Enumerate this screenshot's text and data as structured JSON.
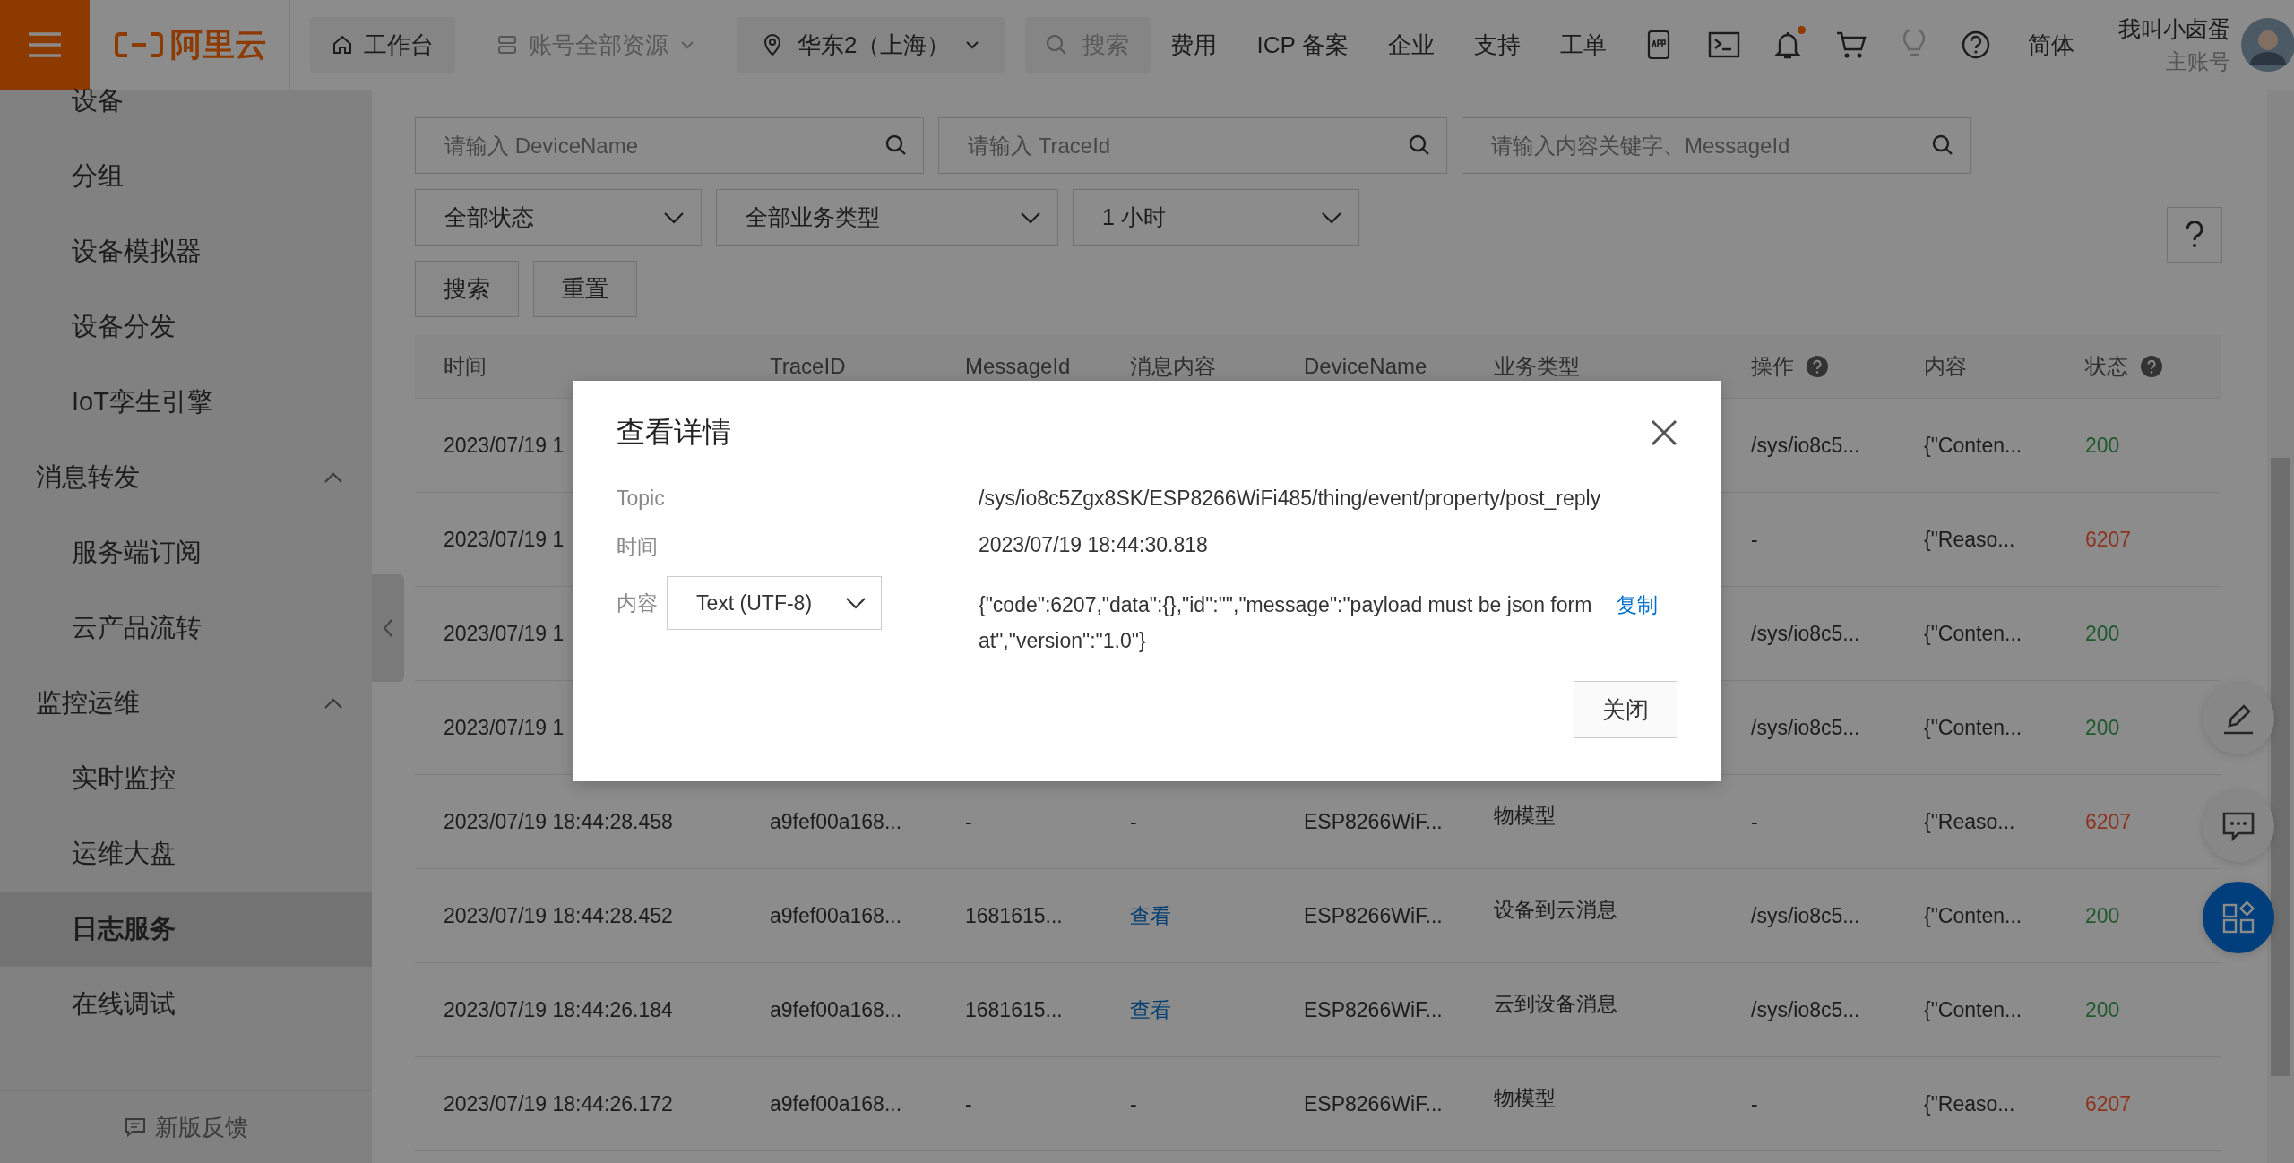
{
  "topbar": {
    "brand": "阿里云",
    "workbench": "工作台",
    "resources": "账号全部资源",
    "region": "华东2（上海）",
    "search_placeholder": "搜索",
    "links": [
      "费用",
      "ICP 备案",
      "企业",
      "支持",
      "工单"
    ],
    "notification_dot": true,
    "language": "简体",
    "user": {
      "name": "我叫小卤蛋",
      "role": "主账号"
    }
  },
  "sidebar": {
    "items": [
      {
        "label": "设备",
        "kind": "item",
        "selected": false
      },
      {
        "label": "分组",
        "kind": "item",
        "selected": false
      },
      {
        "label": "设备模拟器",
        "kind": "item",
        "selected": false
      },
      {
        "label": "设备分发",
        "kind": "item",
        "selected": false
      },
      {
        "label": "IoT孪生引擎",
        "kind": "item",
        "selected": false
      },
      {
        "label": "消息转发",
        "kind": "group",
        "selected": false,
        "expanded": true,
        "children": [
          {
            "label": "服务端订阅",
            "kind": "item",
            "selected": false
          },
          {
            "label": "云产品流转",
            "kind": "item",
            "selected": false
          }
        ]
      },
      {
        "label": "监控运维",
        "kind": "group",
        "selected": false,
        "expanded": true,
        "children": [
          {
            "label": "实时监控",
            "kind": "item",
            "selected": false
          },
          {
            "label": "运维大盘",
            "kind": "item",
            "selected": false
          },
          {
            "label": "日志服务",
            "kind": "item",
            "selected": true
          },
          {
            "label": "在线调试",
            "kind": "item",
            "selected": false
          }
        ]
      }
    ],
    "feedback": "新版反馈"
  },
  "filters": {
    "device_name": {
      "placeholder": "请输入 DeviceName"
    },
    "trace_id": {
      "placeholder": "请输入 TraceId"
    },
    "keyword": {
      "placeholder": "请输入内容关键字、MessageId"
    },
    "selects": [
      "全部状态",
      "全部业务类型",
      "1 小时"
    ],
    "buttons": [
      "搜索",
      "重置"
    ]
  },
  "table": {
    "columns": [
      {
        "label": "时间",
        "help": false
      },
      {
        "label": "TraceID",
        "help": false
      },
      {
        "label": "MessageId",
        "help": false
      },
      {
        "label": "消息内容",
        "help": false
      },
      {
        "label": "DeviceName",
        "help": false
      },
      {
        "label": "业务类型",
        "help": false
      },
      {
        "label": "操作",
        "help": true
      },
      {
        "label": "内容",
        "help": false
      },
      {
        "label": "状态",
        "help": true
      }
    ],
    "rows": [
      {
        "time": "2023/07/19 1",
        "operation": "/sys/io8c5...",
        "content": "{\"Conten...",
        "status": {
          "text": "200",
          "color": "#1f5a2c"
        }
      },
      {
        "time": "2023/07/19 1",
        "operation": "-",
        "content": "{\"Reaso...",
        "status": {
          "text": "6207",
          "color": "#8b3520"
        }
      },
      {
        "time": "2023/07/19 1",
        "operation": "/sys/io8c5...",
        "content": "{\"Conten...",
        "status": {
          "text": "200",
          "color": "#1f5a2c"
        }
      },
      {
        "time": "2023/07/19 1",
        "operation": "/sys/io8c5...",
        "content": "{\"Conten...",
        "status": {
          "text": "200",
          "color": "#1f5a2c"
        }
      },
      {
        "time": "2023/07/19 18:44:28.458",
        "trace_id": "a9fef00a168...",
        "message_id": "-",
        "message_content": {
          "text": "-",
          "kind": "text"
        },
        "device_name": "ESP8266WiF...",
        "type": "物模型",
        "operation": "-",
        "content": "{\"Reaso...",
        "status": {
          "text": "6207",
          "color": "#8b3520"
        }
      },
      {
        "time": "2023/07/19 18:44:28.452",
        "trace_id": "a9fef00a168...",
        "message_id": "1681615...",
        "message_content": {
          "text": "查看",
          "kind": "link"
        },
        "device_name": "ESP8266WiF...",
        "type": "设备到云消息",
        "operation": "/sys/io8c5...",
        "content": "{\"Conten...",
        "status": {
          "text": "200",
          "color": "#1f5a2c"
        }
      },
      {
        "time": "2023/07/19 18:44:26.184",
        "trace_id": "a9fef00a168...",
        "message_id": "1681615...",
        "message_content": {
          "text": "查看",
          "kind": "link"
        },
        "device_name": "ESP8266WiF...",
        "type": "云到设备消息",
        "operation": "/sys/io8c5...",
        "content": "{\"Conten...",
        "status": {
          "text": "200",
          "color": "#1f5a2c"
        }
      },
      {
        "time": "2023/07/19 18:44:26.172",
        "trace_id": "a9fef00a168...",
        "message_id": "-",
        "message_content": {
          "text": "-",
          "kind": "text"
        },
        "device_name": "ESP8266WiF...",
        "type": "物模型",
        "operation": "-",
        "content": "{\"Reaso...",
        "status": {
          "text": "6207",
          "color": "#8b3520"
        }
      }
    ]
  },
  "dialog": {
    "title": "查看详情",
    "fields": [
      {
        "label": "Topic",
        "value": "/sys/io8c5Zgx8SK/ESP8266WiFi485/thing/event/property/post_reply"
      },
      {
        "label": "时间",
        "value": "2023/07/19 18:44:30.818"
      }
    ],
    "content": {
      "label": "内容",
      "format": "Text (UTF-8)",
      "value": "{\"code\":6207,\"data\":{},\"id\":\"\",\"message\":\"payload must be json format\",\"version\":\"1.0\"}",
      "copy": "复制"
    },
    "close_button": "关闭"
  }
}
